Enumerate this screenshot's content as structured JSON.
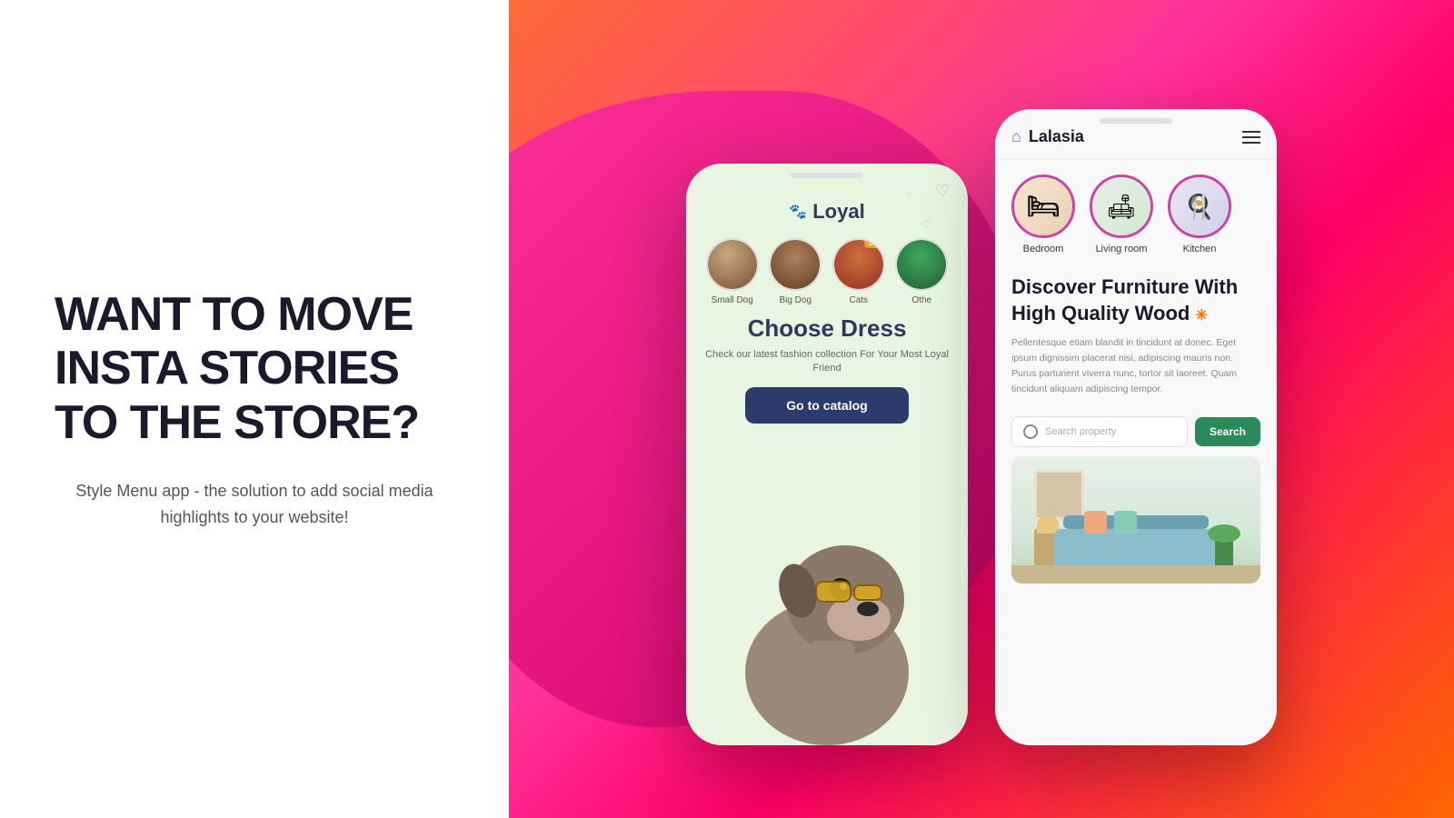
{
  "left": {
    "headline": "WANT TO MOVE INSTA STORIES TO THE STORE?",
    "subtext": "Style Menu app - the solution to add social media highlights to your website!"
  },
  "phone1": {
    "app_name": "Loyal",
    "paw_emoji": "🐾",
    "categories": [
      {
        "label": "Small Dog",
        "has_sale": false
      },
      {
        "label": "Big Dog",
        "has_sale": false
      },
      {
        "label": "Cats",
        "has_sale": true
      },
      {
        "label": "Othe",
        "has_sale": false
      }
    ],
    "section_title": "Choose Dress",
    "section_desc": "Check our latest fashion collection For Your Most Loyal Friend",
    "cta_button": "Go to catalog"
  },
  "phone2": {
    "app_name": "Lalasia",
    "categories": [
      {
        "label": "Bedroom"
      },
      {
        "label": "Living room"
      },
      {
        "label": "Kitchen"
      }
    ],
    "headline_line1": "Discover Furniture With",
    "headline_line2": "High Quality Wood",
    "headline_sparkle": "✳",
    "description": "Pellentesque etiam blandit in tincidunt at donec. Eget ipsum dignissim placerat nisi, adipiscing mauris non. Purus parturient viverra nunc, tortor sit laoreet. Quam tincidunt aliquam adipiscing tempor.",
    "search_placeholder": "Search property",
    "search_button": "Search"
  }
}
